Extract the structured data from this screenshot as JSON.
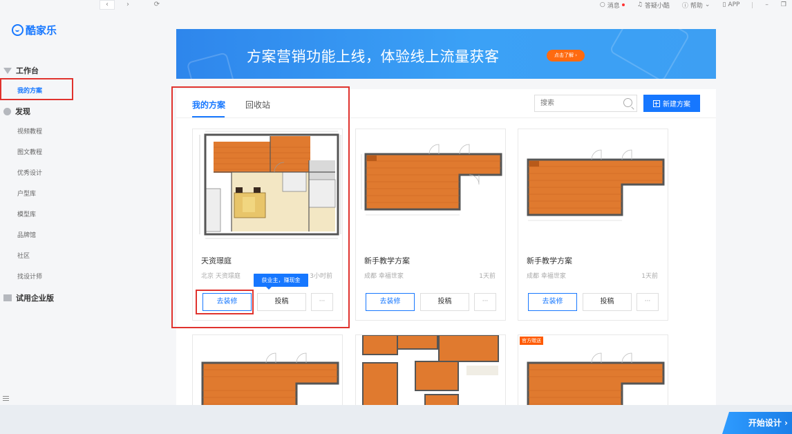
{
  "topbar": {
    "back": "‹",
    "forward": "›",
    "refresh": "⟳",
    "messages": "消息",
    "help_bot": "答疑小酷",
    "help": "帮助",
    "app": "APP",
    "minimize": "–",
    "restore": "❐"
  },
  "sidebar": {
    "logo": "酷家乐",
    "workbench": "工作台",
    "my_plans": "我的方案",
    "discover": "发现",
    "items": [
      "视频教程",
      "图文教程",
      "优秀设计",
      "户型库",
      "模型库",
      "品牌馆",
      "社区",
      "找设计师"
    ],
    "enterprise": "试用企业版"
  },
  "banner": {
    "text": "方案营销功能上线，体验线上流量获客",
    "button": "点击了解 ›"
  },
  "tabs": [
    "我的方案",
    "回收站"
  ],
  "search": {
    "placeholder": "搜索"
  },
  "new_plan": "新建方案",
  "cards": [
    {
      "title": "天资璟庭",
      "subtitle": "北京 天资璟庭",
      "time": "3小时前",
      "btn_deco": "去装修",
      "btn_submit": "投稿",
      "btn_more": "···"
    },
    {
      "title": "新手教学方案",
      "subtitle": "成都 幸福世家",
      "time": "1天前",
      "btn_deco": "去装修",
      "btn_submit": "投稿",
      "btn_more": "···"
    },
    {
      "title": "新手教学方案",
      "subtitle": "成都 幸福世家",
      "time": "1天前",
      "btn_deco": "去装修",
      "btn_submit": "投稿",
      "btn_more": "···"
    }
  ],
  "tooltip": "获业主，赚现金",
  "official_badge": "官方赠送",
  "start_design": "开始设计 ›",
  "colors": {
    "primary": "#1677ff",
    "highlight": "#e0322d",
    "orange": "#ff6a10"
  }
}
